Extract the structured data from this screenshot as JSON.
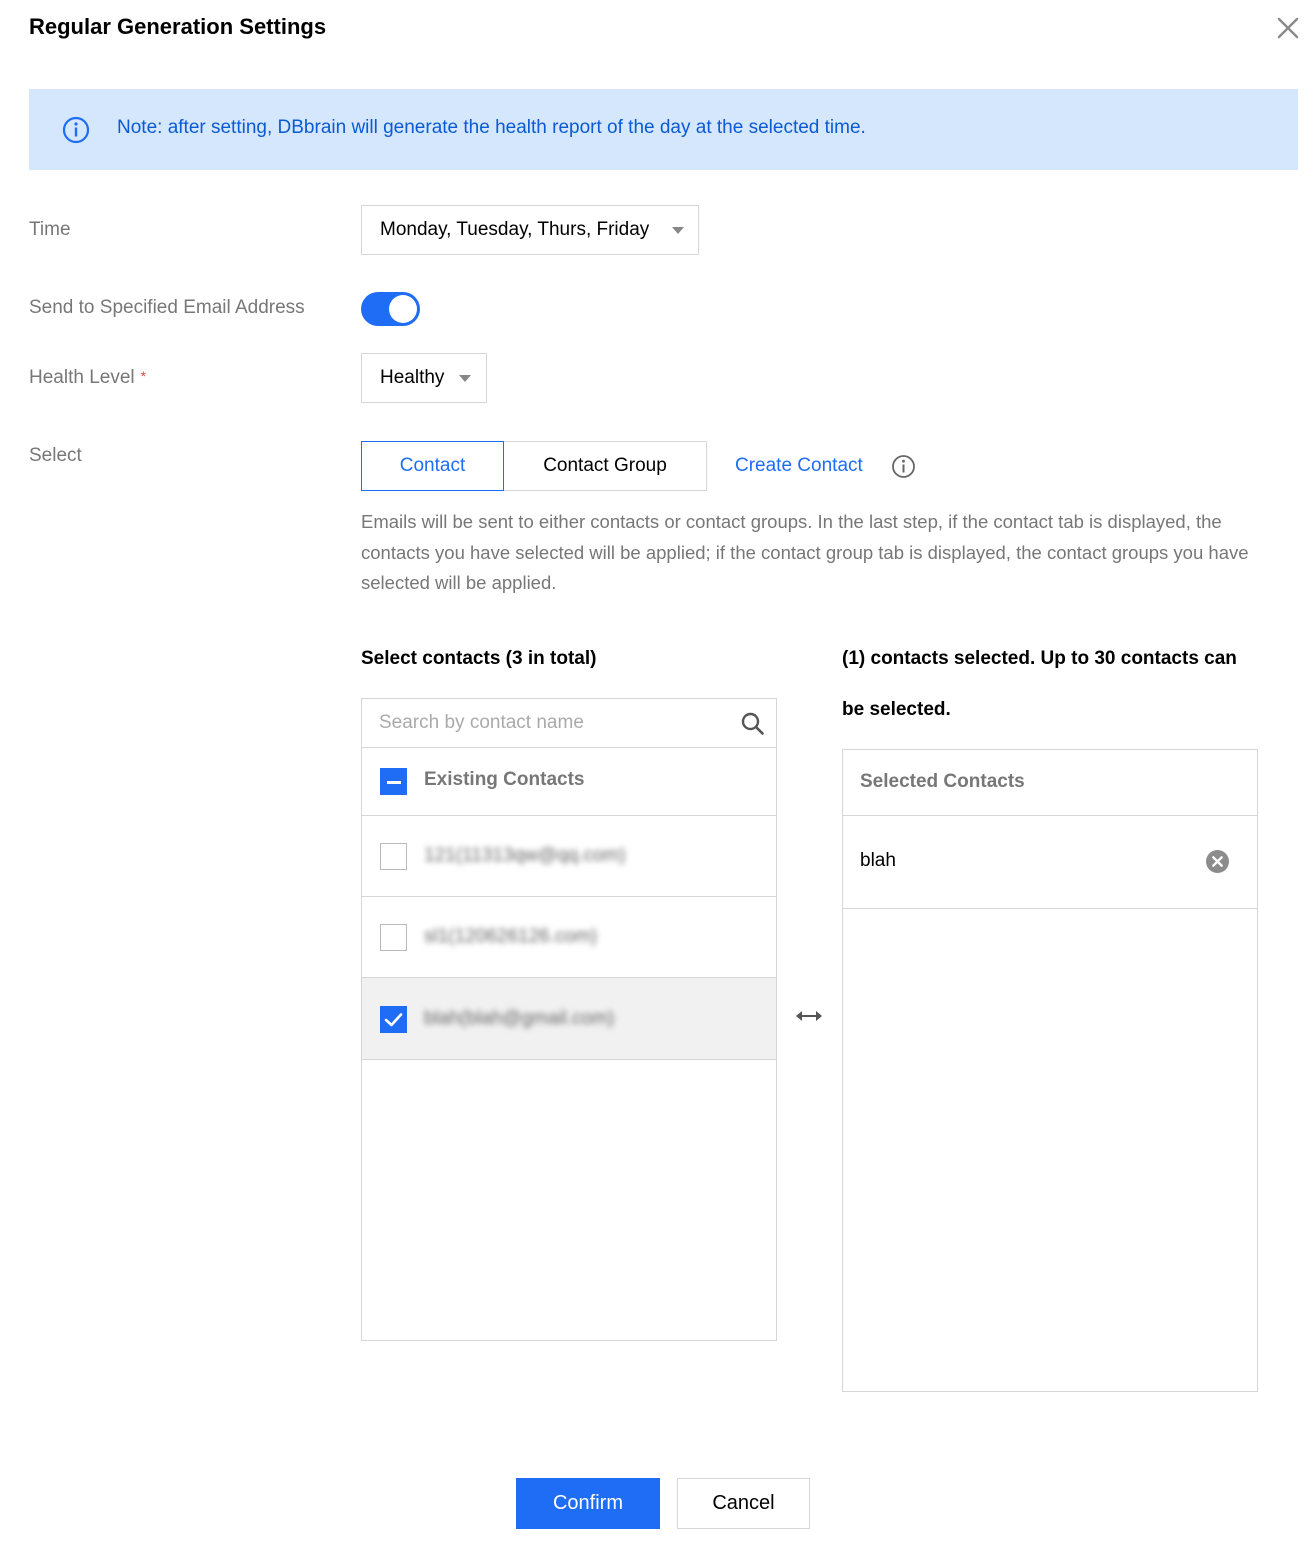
{
  "dialog": {
    "title": "Regular Generation Settings"
  },
  "notice": {
    "text": "Note: after setting, DBbrain will generate the health report of the day at the selected time."
  },
  "form": {
    "time_label": "Time",
    "time_value": "Monday, Tuesday, Thurs, Friday",
    "send_email_label": "Send to Specified Email Address",
    "send_email_enabled": true,
    "health_level_label": "Health Level",
    "health_level_required_mark": "*",
    "health_level_value": "Healthy",
    "select_label": "Select"
  },
  "tabs": [
    {
      "label": "Contact",
      "active": true
    },
    {
      "label": "Contact Group",
      "active": false
    }
  ],
  "create_contact_link": "Create Contact",
  "hint": "Emails will be sent to either contacts or contact groups. In the last step, if the contact tab is displayed, the contacts you have selected will be applied; if the contact group tab is displayed, the contact groups you have selected will be applied.",
  "source": {
    "heading": "Select contacts (3 in total)",
    "search_placeholder": "Search by contact name",
    "group_title": "Existing Contacts",
    "group_checkbox_state": "indeterminate",
    "contacts": [
      {
        "label": "121(11313qw@qq.com)",
        "checked": false
      },
      {
        "label": "sl1(120626126.com)",
        "checked": false
      },
      {
        "label": "blah(blah@gmail.com)",
        "checked": true
      }
    ]
  },
  "target": {
    "heading": "(1) contacts selected. Up to 30 contacts can be selected.",
    "header_title": "Selected Contacts",
    "selected": [
      {
        "name": "blah"
      }
    ]
  },
  "buttons": {
    "confirm": "Confirm",
    "cancel": "Cancel"
  },
  "colors": {
    "primary": "#1f6df5",
    "notice_bg": "#d5e7fd",
    "notice_text": "#0a5bd3",
    "required": "#e54545"
  },
  "icons": [
    "close-icon",
    "info-icon",
    "caret-down-icon",
    "help-icon",
    "search-icon",
    "minus-icon",
    "checkmark-icon",
    "transfer-arrows-icon",
    "remove-circle-icon"
  ]
}
